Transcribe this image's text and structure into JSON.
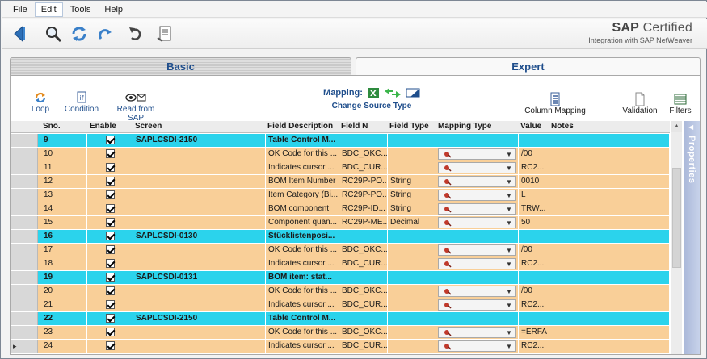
{
  "menu": [
    "File",
    "Edit",
    "Tools",
    "Help"
  ],
  "menu_active": "Edit",
  "brand": {
    "line1_bold": "SAP",
    "line1_rest": " Certified",
    "line2": "Integration with SAP NetWeaver"
  },
  "tabs": {
    "basic": "Basic",
    "expert": "Expert"
  },
  "actions": {
    "loop": "Loop",
    "condition": "Condition",
    "read_from_sap": "Read from SAP",
    "mapping_label": "Mapping:",
    "change_source_type": "Change Source Type",
    "column_mapping": "Column Mapping",
    "validation": "Validation",
    "filters": "Filters"
  },
  "columns": {
    "sno": "Sno.",
    "enable": "Enable",
    "screen": "Screen",
    "field_description": "Field Description",
    "field_name": "Field N",
    "field_type": "Field Type",
    "mapping_type": "Mapping Type",
    "value": "Value",
    "notes": "Notes"
  },
  "sidebar": {
    "properties": "Properties"
  },
  "rows": [
    {
      "sno": "9",
      "group": true,
      "screen": "SAPLCSDI-2150",
      "desc": "Table Control M...",
      "field": "",
      "type": "",
      "combo": false,
      "value": ""
    },
    {
      "sno": "10",
      "group": false,
      "screen": "",
      "desc": "OK Code for this ...",
      "field": "BDC_OKC...",
      "type": "",
      "combo": true,
      "value": "/00"
    },
    {
      "sno": "11",
      "group": false,
      "screen": "",
      "desc": "Indicates cursor ...",
      "field": "BDC_CUR...",
      "type": "",
      "combo": true,
      "value": "RC2..."
    },
    {
      "sno": "12",
      "group": false,
      "screen": "",
      "desc": "BOM Item Number",
      "field": "RC29P-PO...",
      "type": "String",
      "combo": true,
      "value": "0010"
    },
    {
      "sno": "13",
      "group": false,
      "screen": "",
      "desc": "Item Category (Bi...",
      "field": "RC29P-PO...",
      "type": "String",
      "combo": true,
      "value": "L"
    },
    {
      "sno": "14",
      "group": false,
      "screen": "",
      "desc": "BOM component",
      "field": "RC29P-ID...",
      "type": "String",
      "combo": true,
      "value": "TRW..."
    },
    {
      "sno": "15",
      "group": false,
      "screen": "",
      "desc": "Component quan...",
      "field": "RC29P-ME...",
      "type": "Decimal",
      "combo": true,
      "value": "50"
    },
    {
      "sno": "16",
      "group": true,
      "screen": "SAPLCSDI-0130",
      "desc": "Stücklistenposi...",
      "field": "",
      "type": "",
      "combo": false,
      "value": ""
    },
    {
      "sno": "17",
      "group": false,
      "screen": "",
      "desc": "OK Code for this ...",
      "field": "BDC_OKC...",
      "type": "",
      "combo": true,
      "value": "/00"
    },
    {
      "sno": "18",
      "group": false,
      "screen": "",
      "desc": "Indicates cursor ...",
      "field": "BDC_CUR...",
      "type": "",
      "combo": true,
      "value": "RC2..."
    },
    {
      "sno": "19",
      "group": true,
      "screen": "SAPLCSDI-0131",
      "desc": "BOM item: stat...",
      "field": "",
      "type": "",
      "combo": false,
      "value": ""
    },
    {
      "sno": "20",
      "group": false,
      "screen": "",
      "desc": "OK Code for this ...",
      "field": "BDC_OKC...",
      "type": "",
      "combo": true,
      "value": "/00"
    },
    {
      "sno": "21",
      "group": false,
      "screen": "",
      "desc": "Indicates cursor ...",
      "field": "BDC_CUR...",
      "type": "",
      "combo": true,
      "value": "RC2..."
    },
    {
      "sno": "22",
      "group": true,
      "screen": "SAPLCSDI-2150",
      "desc": "Table Control M...",
      "field": "",
      "type": "",
      "combo": false,
      "value": ""
    },
    {
      "sno": "23",
      "group": false,
      "screen": "",
      "desc": "OK Code for this ...",
      "field": "BDC_OKC...",
      "type": "",
      "combo": true,
      "value": "=ERFA"
    },
    {
      "sno": "24",
      "group": false,
      "screen": "",
      "desc": "Indicates cursor ...",
      "field": "BDC_CUR...",
      "type": "",
      "combo": true,
      "value": "RC2...",
      "current": true
    }
  ]
}
